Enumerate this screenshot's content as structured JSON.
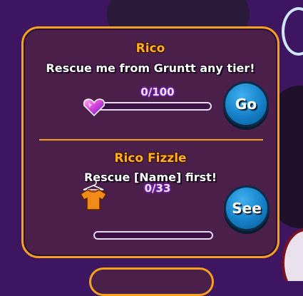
{
  "quests": [
    {
      "name": "Rico",
      "description": "Rescue me from Gruntt any tier!",
      "progress_text": "0/100",
      "progress": 0,
      "button_label": "Go",
      "reward_icon": "heart-gem-icon"
    },
    {
      "name": "Rico Fizzle",
      "description": "Rescue [Name] first!",
      "progress_text": "0/33",
      "progress": 0,
      "button_label": "See",
      "reward_icon": "orange-shirt-icon"
    }
  ],
  "colors": {
    "panel_border": "#f3a01c",
    "panel_bg": "#4a1f4a",
    "name_text": "#ffb020",
    "button_blue": "#1580c8"
  }
}
